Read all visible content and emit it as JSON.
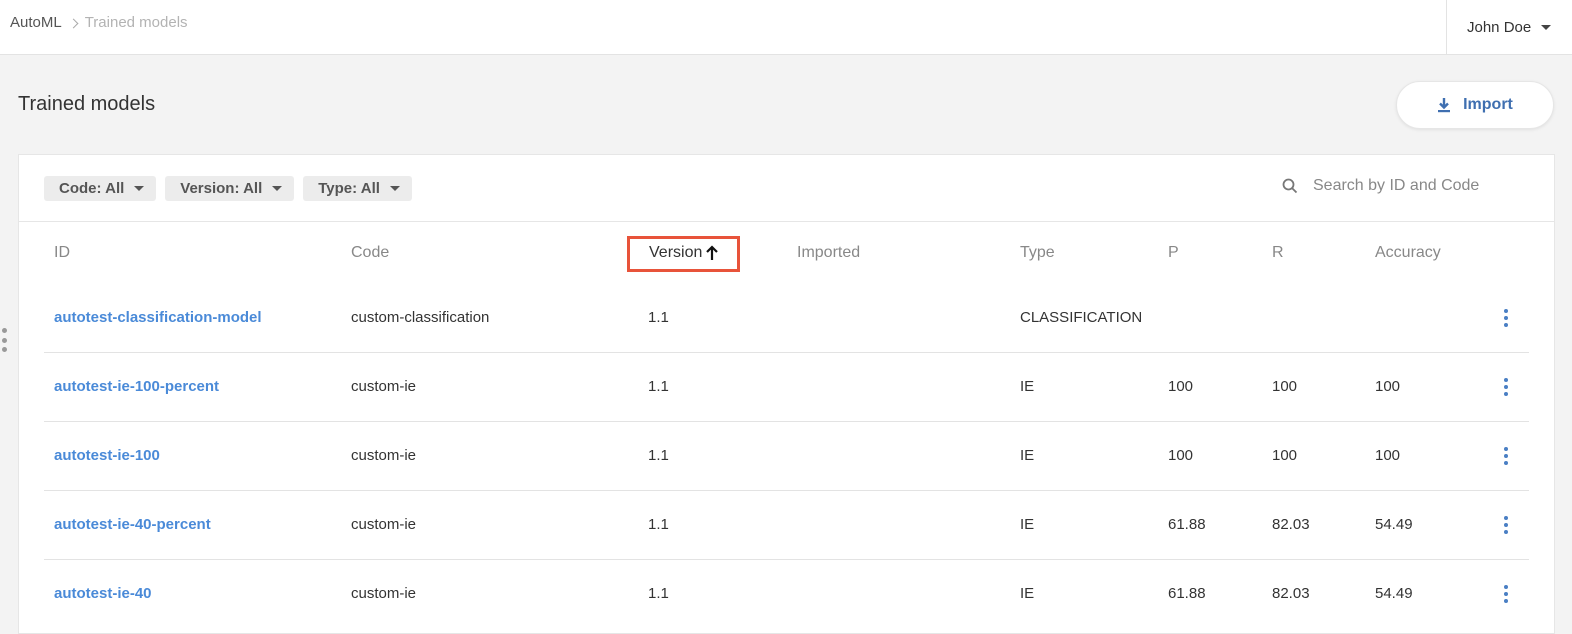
{
  "breadcrumb": {
    "root": "AutoML",
    "current": "Trained models"
  },
  "user": {
    "name": "John Doe"
  },
  "page": {
    "title": "Trained models"
  },
  "import_button": {
    "label": "Import",
    "icon": "download-icon"
  },
  "filters": [
    {
      "label": "Code: All"
    },
    {
      "label": "Version: All"
    },
    {
      "label": "Type: All"
    }
  ],
  "search": {
    "placeholder": "Search by ID and Code",
    "value": ""
  },
  "table": {
    "columns": [
      "ID",
      "Code",
      "Version",
      "Imported",
      "Type",
      "P",
      "R",
      "Accuracy"
    ],
    "sort": {
      "column": "Version",
      "direction": "ascending"
    },
    "rows": [
      {
        "id": "autotest-classification-model",
        "code": "custom-classification",
        "version": "1.1",
        "imported": "",
        "type": "CLASSIFICATION",
        "p": "",
        "r": "",
        "accuracy": ""
      },
      {
        "id": "autotest-ie-100-percent",
        "code": "custom-ie",
        "version": "1.1",
        "imported": "",
        "type": "IE",
        "p": "100",
        "r": "100",
        "accuracy": "100"
      },
      {
        "id": "autotest-ie-100",
        "code": "custom-ie",
        "version": "1.1",
        "imported": "",
        "type": "IE",
        "p": "100",
        "r": "100",
        "accuracy": "100"
      },
      {
        "id": "autotest-ie-40-percent",
        "code": "custom-ie",
        "version": "1.1",
        "imported": "",
        "type": "IE",
        "p": "61.88",
        "r": "82.03",
        "accuracy": "54.49"
      },
      {
        "id": "autotest-ie-40",
        "code": "custom-ie",
        "version": "1.1",
        "imported": "",
        "type": "IE",
        "p": "61.88",
        "r": "82.03",
        "accuracy": "54.49"
      }
    ]
  },
  "colors": {
    "accent": "#4a8ad8",
    "highlight": "#e8533a",
    "import_text": "#3f6fb0"
  }
}
